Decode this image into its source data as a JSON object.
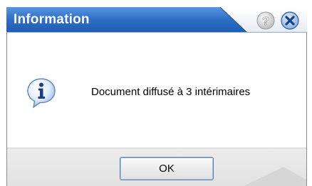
{
  "dialog": {
    "title": "Information",
    "message": "Document diffusé à 3 intérimaires",
    "ok_label": "OK"
  },
  "icons": {
    "help": "help-icon",
    "close": "close-icon",
    "info": "info-icon"
  },
  "colors": {
    "titlebar_blue": "#2a6fc9",
    "titlebar_light": "#f4f6fa",
    "close_blue": "#1c4fa8"
  }
}
